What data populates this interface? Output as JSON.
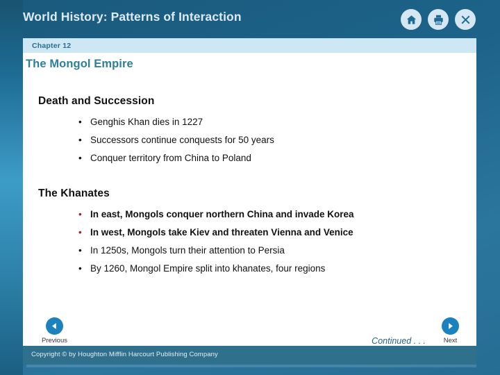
{
  "header": {
    "title": "World History: Patterns of Interaction",
    "icons": [
      {
        "name": "home-icon",
        "label": "Home"
      },
      {
        "name": "print-icon",
        "label": "Print"
      },
      {
        "name": "close-icon",
        "label": "X"
      }
    ]
  },
  "chapter": {
    "label": "Chapter 12"
  },
  "lesson": {
    "title": "The Mongol Empire"
  },
  "sections": [
    {
      "heading": "Death and Succession",
      "bullets": [
        {
          "marker": "•",
          "text": "Genghis Khan dies in 1227",
          "highlight": false
        },
        {
          "marker": "•",
          "text": "Successors continue conquests for 50 years",
          "highlight": false
        },
        {
          "marker": "•",
          "text": "Conquer territory from China to Poland",
          "highlight": false
        }
      ]
    },
    {
      "heading": "The Khanates",
      "bullets": [
        {
          "marker": "•",
          "text": "In east, Mongols conquer northern China and invade Korea",
          "highlight": true
        },
        {
          "marker": "•",
          "text": "In west, Mongols take Kiev and threaten Vienna and Venice",
          "highlight": true
        },
        {
          "marker": "•",
          "text": "In 1250s, Mongols turn their attention to Persia",
          "highlight": false
        },
        {
          "marker": "•",
          "text": "By 1260, Mongol Empire split into khanates, four regions",
          "highlight": false
        }
      ]
    }
  ],
  "footer": {
    "previous_label": "Previous",
    "next_label": "Next",
    "continued_label": "Continued . . .",
    "copyright": "Copyright © by Houghton Mifflin Harcourt Publishing Company"
  },
  "colors": {
    "header_background": "#1d6389",
    "panel_background": "#ffffff",
    "chapter_bar": "#cde7f4",
    "lesson_title": "#2d7f9c",
    "highlight_text": "#9e2223",
    "nav_button": "#1b82bd",
    "copyright_bar": "#2f708d"
  }
}
